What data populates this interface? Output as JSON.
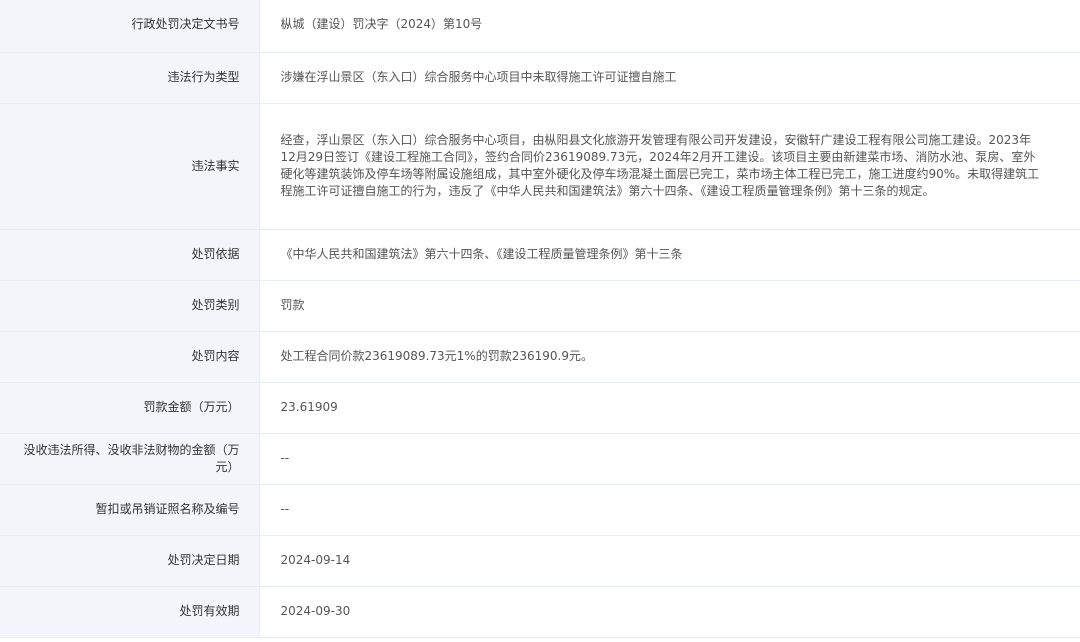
{
  "rows": [
    {
      "label": "行政处罚决定文书号",
      "value": "枞城（建设）罚决字（2024）第10号"
    },
    {
      "label": "违法行为类型",
      "value": "涉嫌在浮山景区（东入口）综合服务中心项目中未取得施工许可证擅自施工"
    },
    {
      "label": "违法事实",
      "value": "经查，浮山景区（东入口）综合服务中心项目，由枞阳县文化旅游开发管理有限公司开发建设，安徽轩广建设工程有限公司施工建设。2023年12月29日签订《建设工程施工合同》，签约合同价23619089.73元，2024年2月开工建设。该项目主要由新建菜市场、消防水池、泵房、室外硬化等建筑装饰及停车场等附属设施组成，其中室外硬化及停车场混凝土面层已完工，菜市场主体工程已完工，施工进度约90%。未取得建筑工程施工许可证擅自施工的行为，违反了《中华人民共和国建筑法》第六十四条、《建设工程质量管理条例》第十三条的规定。"
    },
    {
      "label": "处罚依据",
      "value": "《中华人民共和国建筑法》第六十四条、《建设工程质量管理条例》第十三条"
    },
    {
      "label": "处罚类别",
      "value": "罚款"
    },
    {
      "label": "处罚内容",
      "value": "处工程合同价款23619089.73元1%的罚款236190.9元。"
    },
    {
      "label": "罚款金额（万元）",
      "value": "23.61909"
    },
    {
      "label": "没收违法所得、没收非法财物的金额（万元）",
      "value": "--"
    },
    {
      "label": "暂扣或吊销证照名称及编号",
      "value": "--"
    },
    {
      "label": "处罚决定日期",
      "value": "2024-09-14"
    },
    {
      "label": "处罚有效期",
      "value": "2024-09-30"
    }
  ]
}
